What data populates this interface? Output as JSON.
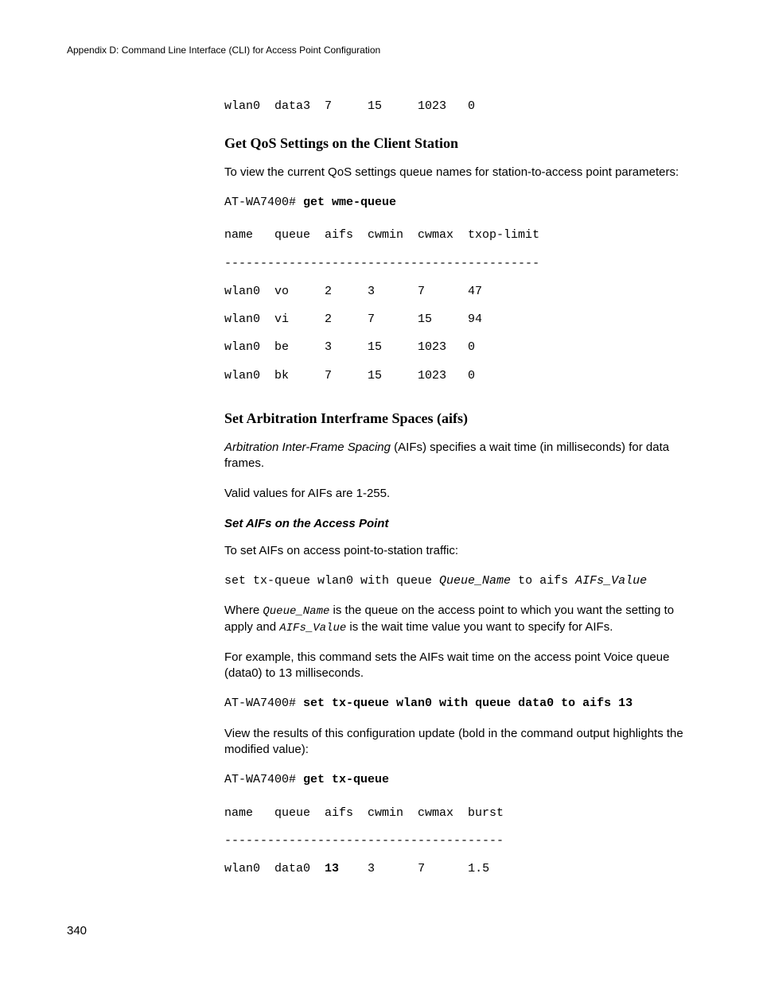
{
  "header": "Appendix D: Command Line Interface (CLI) for Access Point Configuration",
  "topRow": "wlan0  data3  7     15     1023   0",
  "h1": "Get QoS Settings on the Client Station",
  "p1": "To view the current QoS settings queue names for station-to-access point parameters:",
  "prompt": "AT-WA7400# ",
  "cmd1": "get wme-queue",
  "table1": {
    "head": "name   queue  aifs  cwmin  cwmax  txop-limit",
    "rule": "--------------------------------------------",
    "r0": "wlan0  vo     2     3      7      47",
    "r1": "wlan0  vi     2     7      15     94",
    "r2": "wlan0  be     3     15     1023   0",
    "r3": "wlan0  bk     7     15     1023   0"
  },
  "h2": "Set Arbitration Interframe Spaces (aifs)",
  "p2a": "Arbitration Inter-Frame Spacing",
  "p2b": " (AIFs) specifies a wait time (in milliseconds) for data frames.",
  "p3": "Valid values for AIFs are 1-255.",
  "sub1": "Set AIFs on the Access Point",
  "p4": "To set AIFs on access point-to-station traffic:",
  "cmd2a": "set tx-queue wlan0 with queue ",
  "cmd2b": "Queue_Name",
  "cmd2c": " to aifs ",
  "cmd2d": "AIFs_Value",
  "p5a": "Where ",
  "p5b": "Queue_Name",
  "p5c": " is the queue on the access point to which you want the setting to apply and ",
  "p5d": "AIFs_Value",
  "p5e": " is the wait time value you want to specify for AIFs.",
  "p6": "For example, this command sets the AIFs wait time on the access point Voice queue (data0) to 13 milliseconds.",
  "cmd3": "set tx-queue wlan0 with queue data0 to aifs 13",
  "p7": "View the results of this configuration update (bold in the command output highlights the modified value):",
  "cmd4": "get tx-queue",
  "table2": {
    "head": "name   queue  aifs  cwmin  cwmax  burst",
    "rule": "---------------------------------------",
    "r0a": "wlan0  data0  ",
    "r0b": "13",
    "r0c": "    3      7      1.5"
  },
  "pageNum": "340"
}
